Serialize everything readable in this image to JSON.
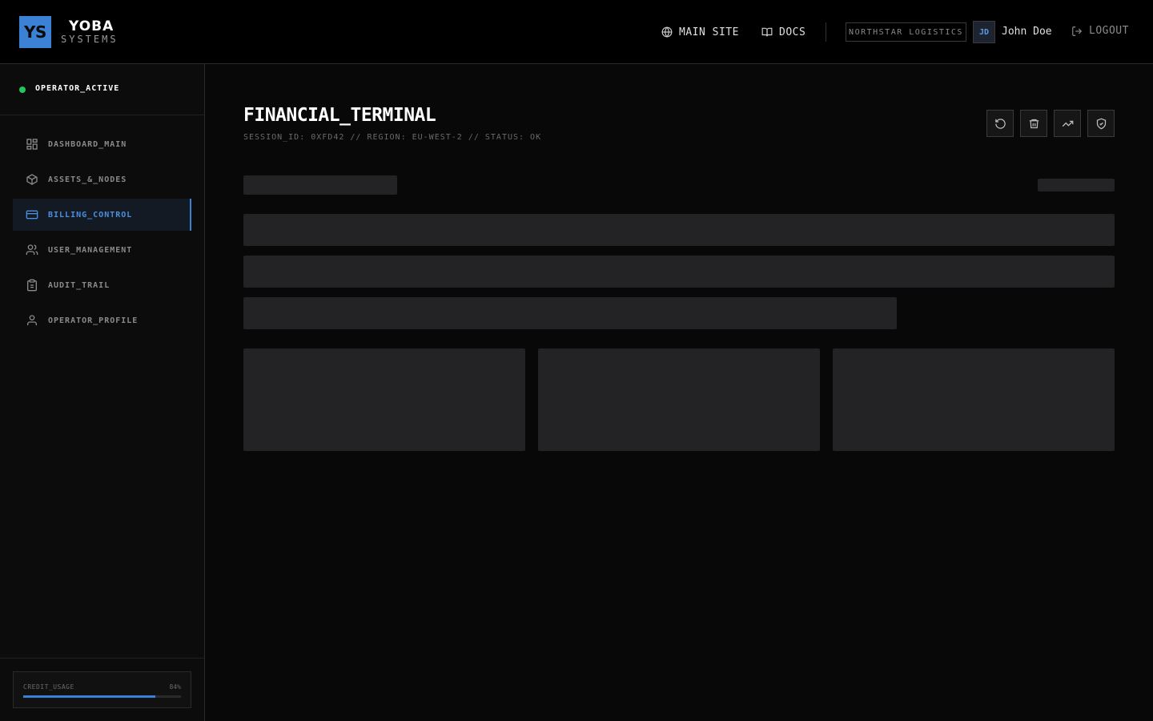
{
  "brand": {
    "mark": "YS",
    "title": "YOBA",
    "subtitle": "SYSTEMS",
    "accent": "#3b82d6"
  },
  "header": {
    "nav": [
      {
        "label": "MAIN SITE",
        "icon": "globe-icon"
      },
      {
        "label": "DOCS",
        "icon": "book-icon"
      }
    ],
    "org": "NORTHSTAR LOGISTICS",
    "user": {
      "initials": "JD",
      "name": "John Doe"
    },
    "logout": {
      "label": "LOGOUT",
      "icon": "logout-icon"
    }
  },
  "sidebar": {
    "status": {
      "label": "OPERATOR_ACTIVE",
      "color": "#22c55e"
    },
    "items": [
      {
        "label": "DASHBOARD_MAIN",
        "icon": "grid-icon",
        "active": false
      },
      {
        "label": "ASSETS_&_NODES",
        "icon": "cube-icon",
        "active": false
      },
      {
        "label": "BILLING_CONTROL",
        "icon": "credit-card-icon",
        "active": true
      },
      {
        "label": "USER_MANAGEMENT",
        "icon": "users-icon",
        "active": false
      },
      {
        "label": "AUDIT_TRAIL",
        "icon": "clipboard-icon",
        "active": false
      },
      {
        "label": "OPERATOR_PROFILE",
        "icon": "user-icon",
        "active": false
      }
    ],
    "credit": {
      "label": "CREDIT_USAGE",
      "percent_label": "84%",
      "value": 0.84
    }
  },
  "main": {
    "title": "FINANCIAL_TERMINAL",
    "meta": "SESSION_ID: 0XFD42 // REGION: EU-WEST-2 // STATUS: OK",
    "tools": [
      {
        "icon": "refresh-icon"
      },
      {
        "icon": "trash-icon"
      },
      {
        "icon": "trending-up-icon"
      },
      {
        "icon": "shield-check-icon"
      }
    ]
  }
}
